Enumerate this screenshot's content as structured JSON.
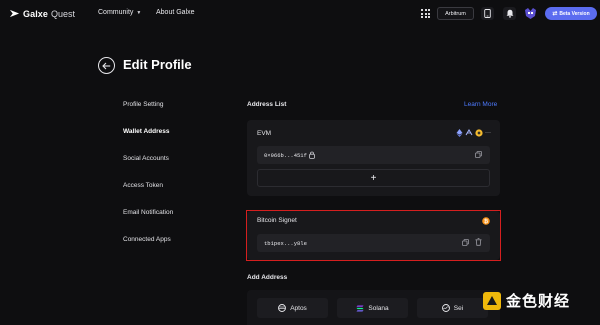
{
  "nav": {
    "brand": "Galxe",
    "brand_suffix": "Quest",
    "links": [
      {
        "label": "Community",
        "has_dropdown": true
      },
      {
        "label": "About Galxe",
        "has_dropdown": false
      }
    ],
    "network_label": "Arbitrum",
    "beta_label": "Beta Version",
    "icons": [
      "apps-grid-icon",
      "phone-icon",
      "bell-icon",
      "avatar"
    ]
  },
  "page": {
    "title": "Edit Profile",
    "back_icon": "arrow-left-icon"
  },
  "sidebar": {
    "items": [
      {
        "label": "Profile Setting",
        "active": false
      },
      {
        "label": "Wallet Address",
        "active": true
      },
      {
        "label": "Social Accounts",
        "active": false
      },
      {
        "label": "Access Token",
        "active": false
      },
      {
        "label": "Email Notification",
        "active": false
      },
      {
        "label": "Connected Apps",
        "active": false
      }
    ]
  },
  "address_list": {
    "title": "Address List",
    "learn_more": "Learn More",
    "evm": {
      "label": "EVM",
      "address": "0×966b...451f",
      "copy_icon": "copy-icon",
      "add_icon": "plus-icon"
    },
    "bitcoin": {
      "label": "Bitcoin Signet",
      "address": "tb1pex...y8le",
      "icons": [
        "copy-icon",
        "trash-icon"
      ],
      "badge_color": "#f7931a"
    }
  },
  "add_address": {
    "title": "Add Address",
    "chains": [
      {
        "label": "Aptos",
        "icon": "aptos-icon"
      },
      {
        "label": "Solana",
        "icon": "solana-icon"
      },
      {
        "label": "Sei",
        "icon": "sei-icon"
      }
    ]
  },
  "watermark": {
    "text": "金色财经"
  },
  "colors": {
    "background": "#0e0e10",
    "card": "#18181b",
    "accent": "#4e7bff",
    "beta": "#5b6cf0",
    "highlight": "#d51f1f"
  }
}
